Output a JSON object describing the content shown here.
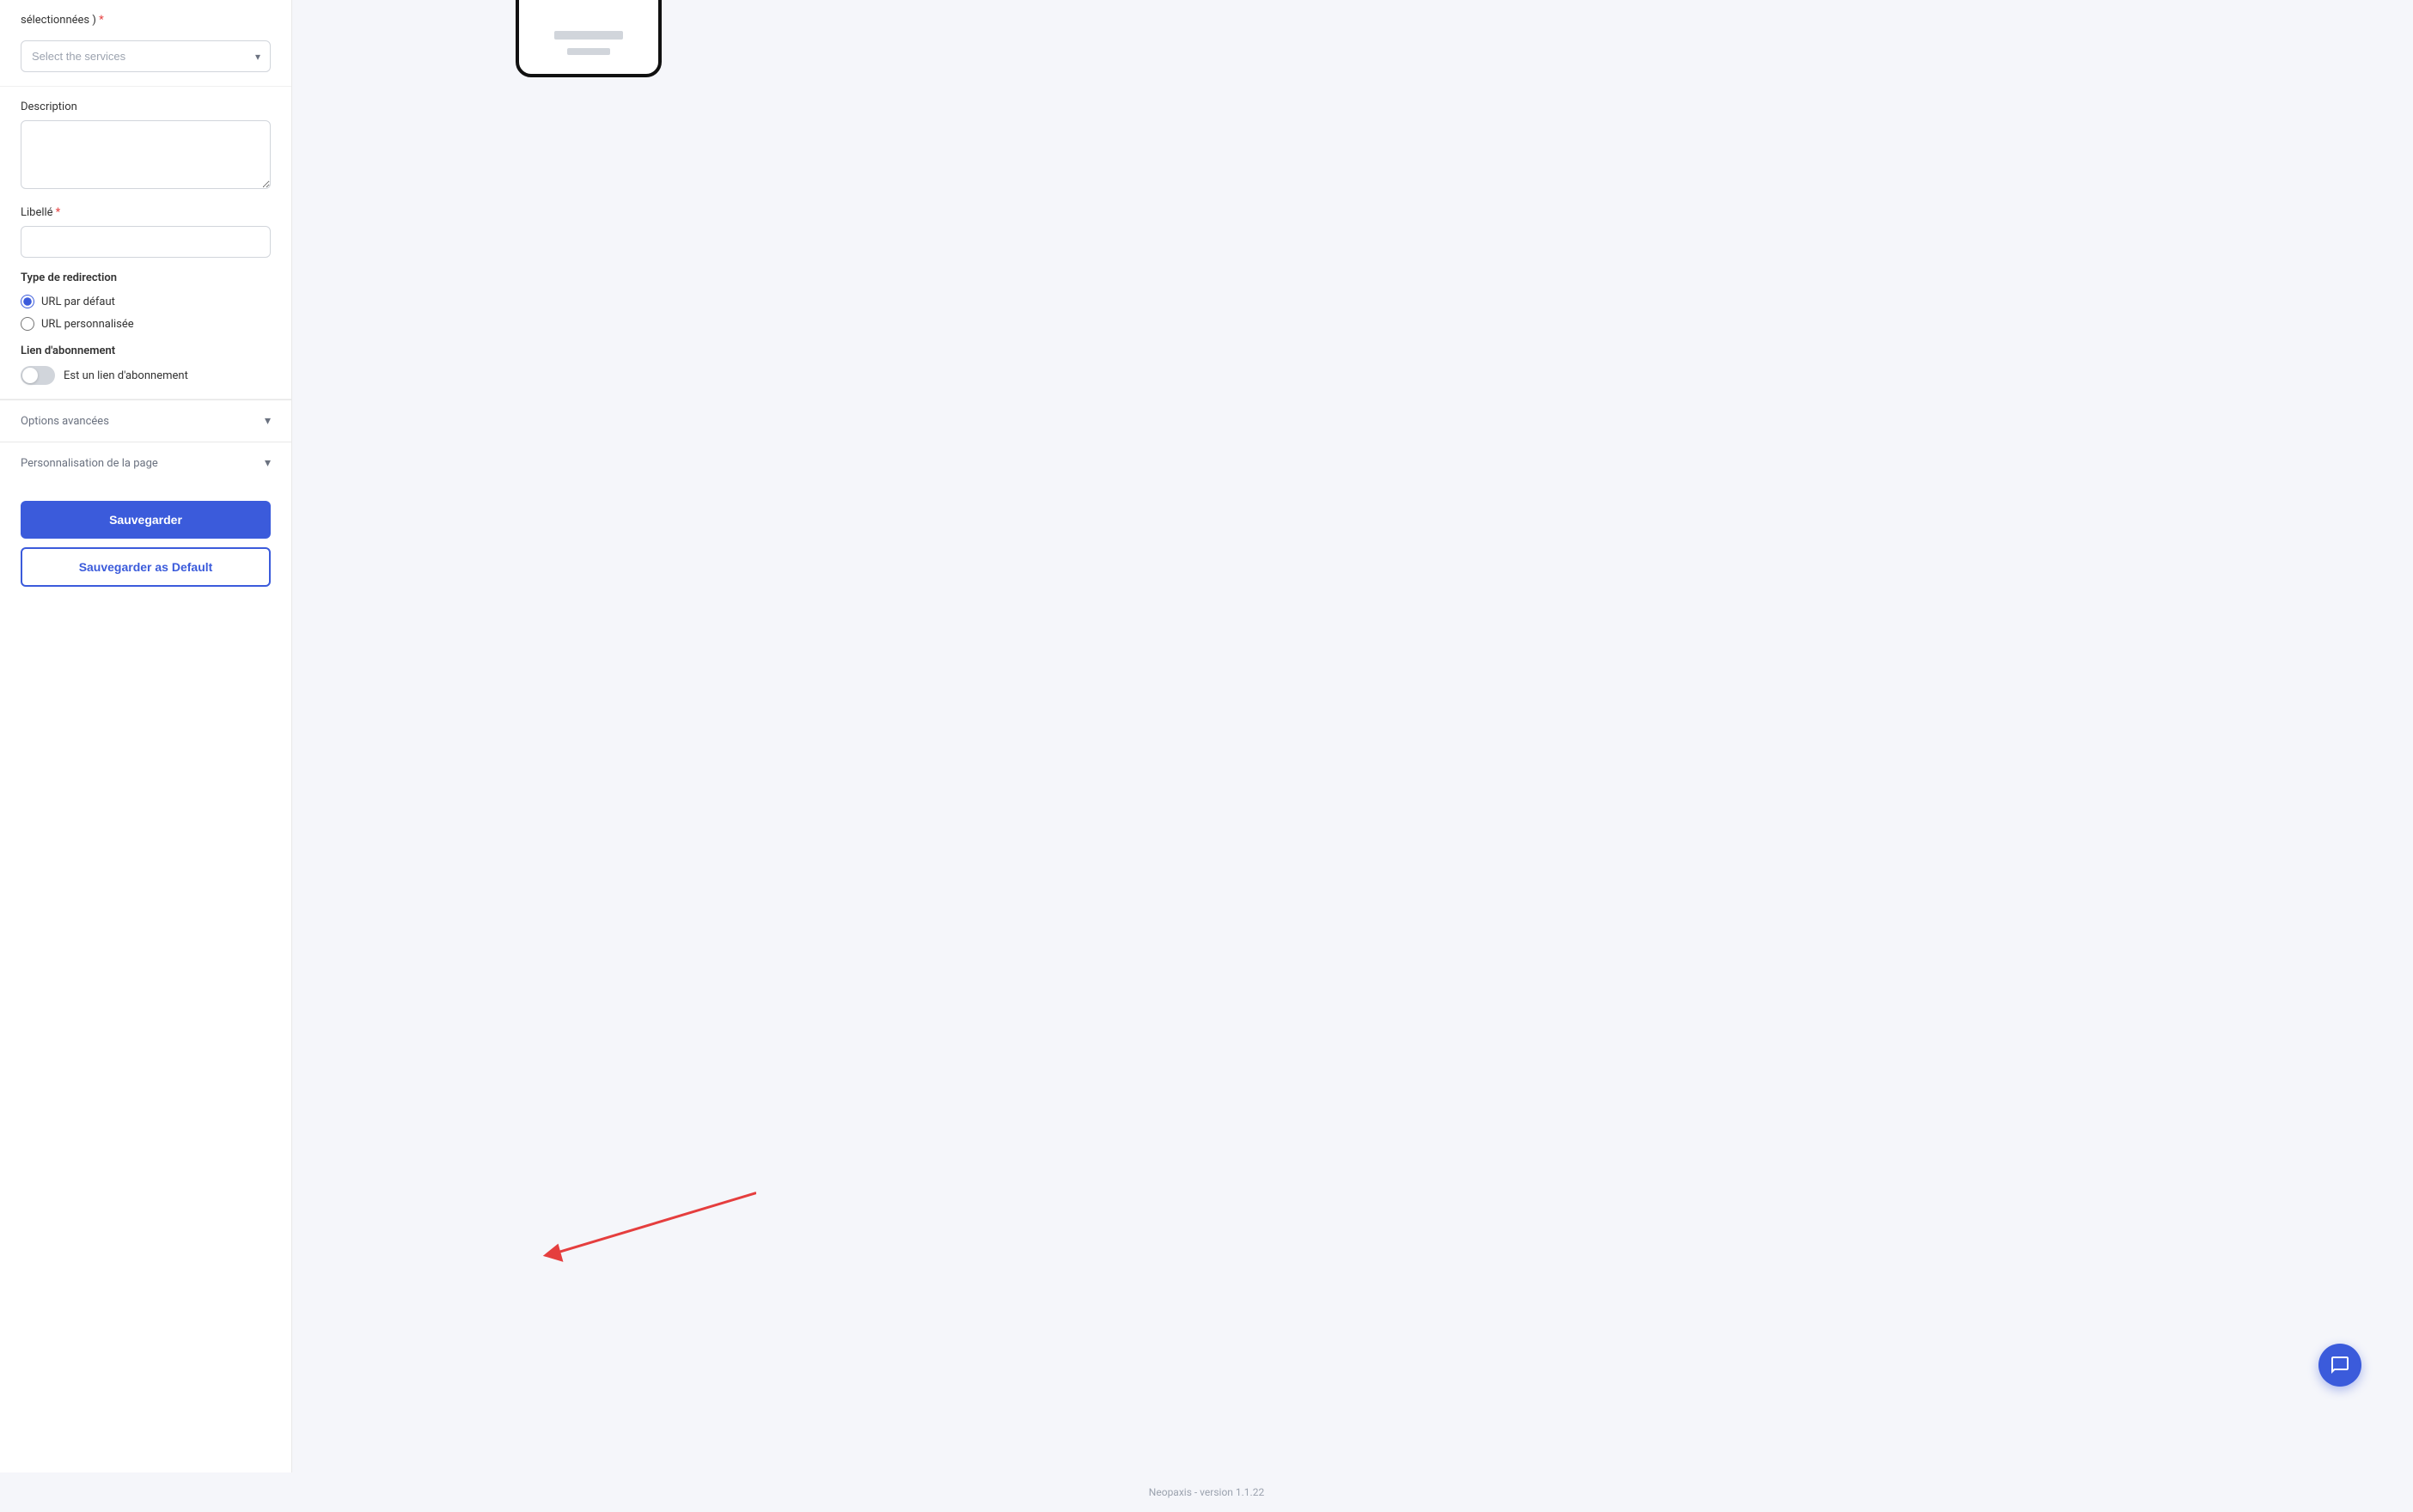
{
  "form": {
    "services_label": "sélectionnées )",
    "services_required": true,
    "services_placeholder": "Select the services",
    "description_label": "Description",
    "description_placeholder": "",
    "libelle_label": "Libellé",
    "libelle_required": true,
    "libelle_placeholder": "",
    "redirection_type_label": "Type de redirection",
    "radio_options": [
      {
        "id": "url-defaut",
        "label": "URL par défaut",
        "checked": true
      },
      {
        "id": "url-personnalisee",
        "label": "URL personnalisée",
        "checked": false
      }
    ],
    "abonnement_label": "Lien d'abonnement",
    "abonnement_toggle_label": "Est un lien d'abonnement",
    "options_avancees_label": "Options avancées",
    "personalisation_label": "Personnalisation de la page",
    "save_button_label": "Sauvegarder",
    "save_default_button_label": "Sauvegarder as Default"
  },
  "footer": {
    "text": "Neopaxis - version 1.1.22"
  },
  "icons": {
    "chevron_down": "▾",
    "chat": "💬",
    "arrow": "→"
  },
  "colors": {
    "primary": "#3b5bdb",
    "required": "#e53e3e",
    "border": "#d1d5db",
    "text_muted": "#6b7280"
  }
}
